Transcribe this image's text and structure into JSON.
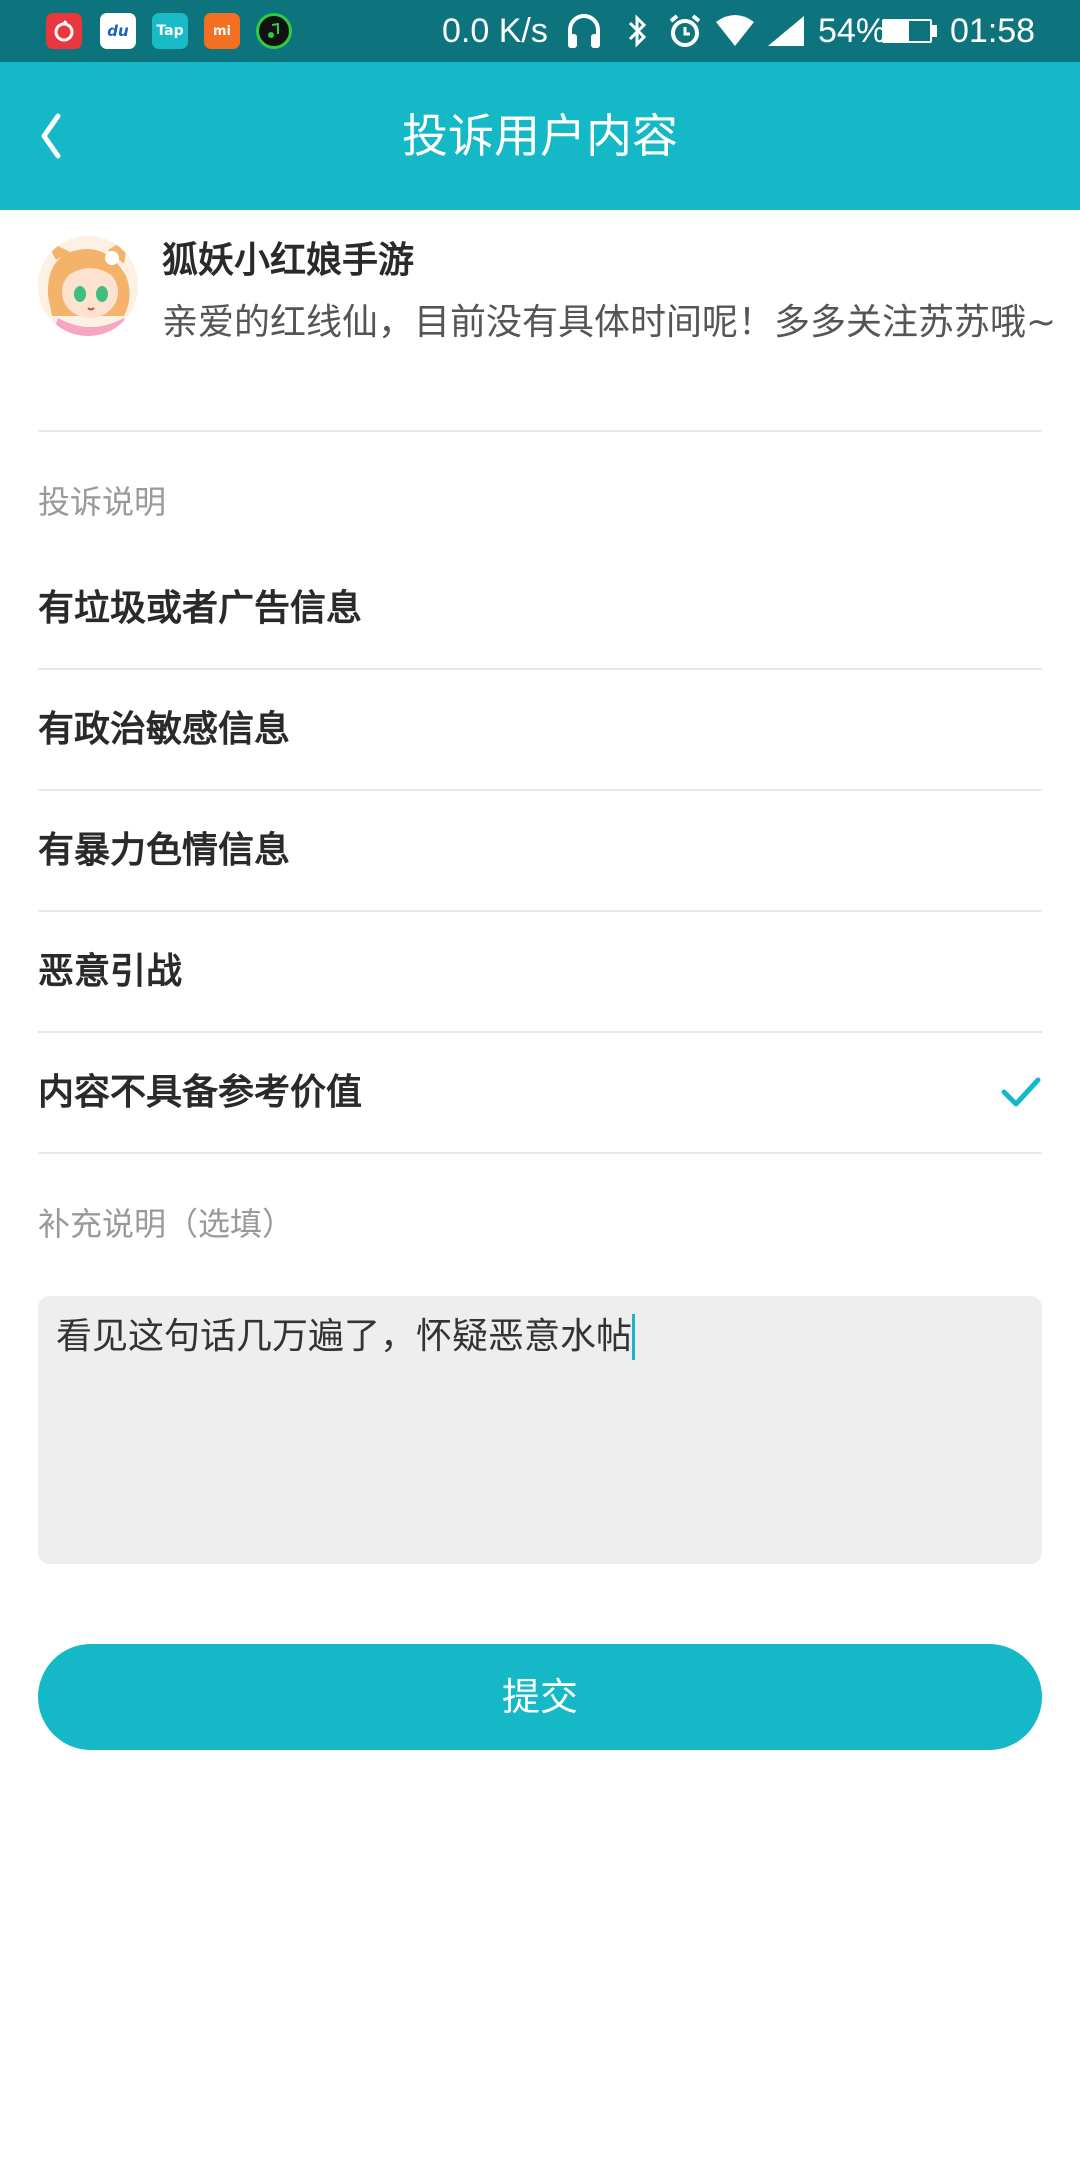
{
  "status_bar": {
    "net_speed": "0.0 K/s",
    "battery_percent": "54%",
    "battery_level": 0.54,
    "time": "01:58",
    "app_icons": [
      "netease-cloud-music-icon",
      "du-app-icon",
      "taptap-icon",
      "mi-store-icon",
      "music-player-icon"
    ],
    "app_icon_labels": {
      "du": "du",
      "tap": "Tap",
      "mi": "mi"
    },
    "system_icons": [
      "headphones-icon",
      "bluetooth-icon",
      "alarm-icon",
      "wifi-icon",
      "cell-signal-icon",
      "battery-icon"
    ]
  },
  "header": {
    "title": "投诉用户内容",
    "back_icon": "back-arrow-icon",
    "background": "#14b8c7"
  },
  "reported_content": {
    "user_name": "狐妖小红娘手游",
    "message": "亲爱的红线仙，目前没有具体时间呢！多多关注苏苏哦~"
  },
  "complaint": {
    "section_label": "投诉说明",
    "options": [
      {
        "label": "有垃圾或者广告信息",
        "selected": false
      },
      {
        "label": "有政治敏感信息",
        "selected": false
      },
      {
        "label": "有暴力色情信息",
        "selected": false
      },
      {
        "label": "恶意引战",
        "selected": false
      },
      {
        "label": "内容不具备参考价值",
        "selected": true
      }
    ],
    "selected_icon": "checkmark-icon"
  },
  "supplement": {
    "section_label": "补充说明（选填）",
    "value": "看见这句话几万遍了，怀疑恶意水帖"
  },
  "submit": {
    "label": "提交"
  },
  "colors": {
    "accent": "#14b8c7",
    "status_bar": "#0d747d"
  }
}
